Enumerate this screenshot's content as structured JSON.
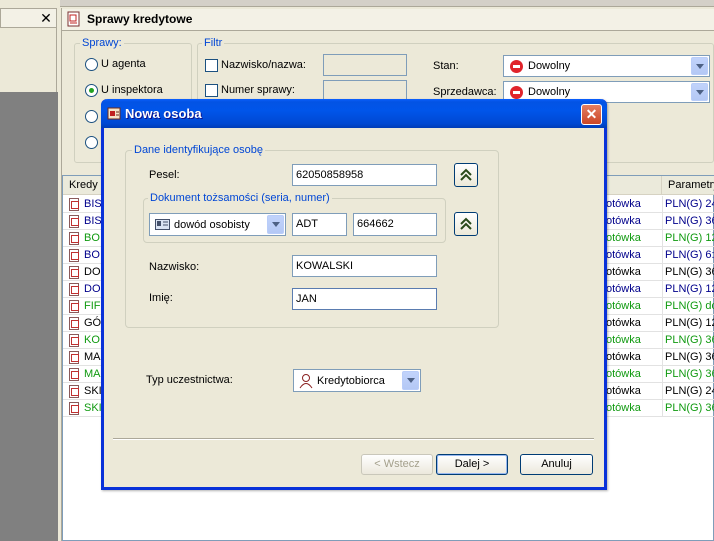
{
  "left_panel": {
    "close_glyph": "✕"
  },
  "main": {
    "title": "Sprawy kredytowe",
    "sprawy": {
      "label": "Sprawy:",
      "options": [
        {
          "label": "U agenta",
          "checked": false
        },
        {
          "label": "U inspektora",
          "checked": true
        },
        {
          "label": "",
          "checked": false
        },
        {
          "label": "",
          "checked": false
        }
      ]
    },
    "filtr": {
      "label": "Filtr",
      "nazwisko_label": "Nazwisko/nazwa:",
      "numer_label": "Numer sprawy:",
      "stan_label": "Stan:",
      "stan_value": "Dowolny",
      "sprzedawca_label": "Sprzedawca:",
      "sprzedawca_value": "Dowolny"
    },
    "list": {
      "headers": [
        "Kredy",
        "Parametry"
      ],
      "rows": [
        {
          "name": "BIS",
          "type": "otówka",
          "params": "PLN(G) 24",
          "color": "#00008b"
        },
        {
          "name": "BIS",
          "type": "otówka",
          "params": "PLN(G) 36",
          "color": "#00008b"
        },
        {
          "name": "BO",
          "type": "otówka",
          "params": "PLN(G) 12",
          "color": "#109a10"
        },
        {
          "name": "BO",
          "type": "otówka",
          "params": "PLN(G) 6:1",
          "color": "#00008b"
        },
        {
          "name": "DO",
          "type": "otówka",
          "params": "PLN(G) 36",
          "color": "#000000"
        },
        {
          "name": "DO",
          "type": "otówka",
          "params": "PLN(G) 12",
          "color": "#00008b"
        },
        {
          "name": "FIF",
          "type": "otówka",
          "params": "PLN(G) do",
          "color": "#109a10"
        },
        {
          "name": "GÓ",
          "type": "otówka",
          "params": "PLN(G) 12",
          "color": "#000000"
        },
        {
          "name": "KO",
          "type": "otówka",
          "params": "PLN(G) 36",
          "color": "#109a10"
        },
        {
          "name": "MA",
          "type": "otówka",
          "params": "PLN(G) 36",
          "color": "#000000"
        },
        {
          "name": "MA",
          "type": "otówka",
          "params": "PLN(G) 36",
          "color": "#109a10"
        },
        {
          "name": "SKI",
          "type": "otówka",
          "params": "PLN(G) 24",
          "color": "#000000"
        },
        {
          "name": "SKI",
          "type": "otówka",
          "params": "PLN(G) 36",
          "color": "#109a10"
        }
      ]
    }
  },
  "dialog": {
    "title": "Nowa osoba",
    "close_glyph": "✕",
    "group_label": "Dane identyfikujące osobę",
    "pesel_label": "Pesel:",
    "pesel_value": "62050858958",
    "doc_group_label": "Dokument tożsamości (seria, numer)",
    "doc_type": "dowód osobisty",
    "doc_series": "ADT",
    "doc_number": "664662",
    "nazwisko_label": "Nazwisko:",
    "nazwisko_value": "KOWALSKI",
    "imie_label": "Imię:",
    "imie_value": "JAN",
    "typ_label": "Typ uczestnictwa:",
    "typ_value": "Kredytobiorca",
    "back_label": "< Wstecz",
    "next_label": "Dalej >",
    "cancel_label": "Anuluj"
  },
  "colors": {
    "accent": "#0054e3",
    "group_label": "#0046d5",
    "green_row": "#109a10",
    "blue_row": "#00008b"
  }
}
